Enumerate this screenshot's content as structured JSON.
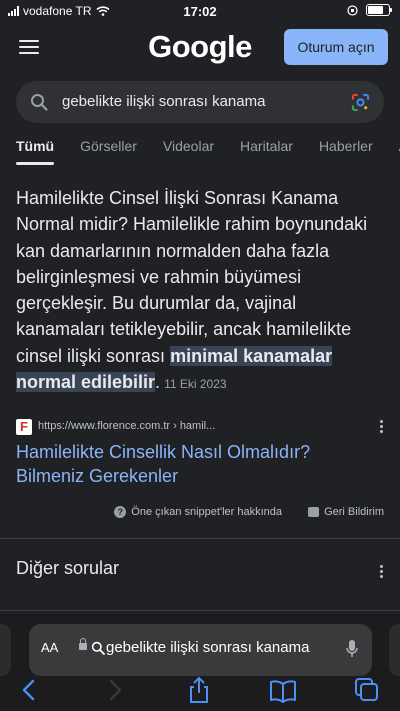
{
  "status_bar": {
    "carrier": "vodafone TR",
    "time": "17:02"
  },
  "header": {
    "logo": "Google",
    "signin_label": "Oturum açın"
  },
  "search": {
    "query": "gebelikte ilişki sonrası kanama"
  },
  "tabs": [
    {
      "label": "Tümü",
      "active": true
    },
    {
      "label": "Görseller"
    },
    {
      "label": "Videolar"
    },
    {
      "label": "Haritalar"
    },
    {
      "label": "Haberler"
    },
    {
      "label": "Al"
    }
  ],
  "featured_snippet": {
    "text": "Hamilelikte Cinsel İlişki Sonrası Kanama Normal midir? Hamilelikle rahim boynundaki kan damarlarının normalden daha fazla belirginleşmesi ve rahmin büyümesi gerçekleşir. Bu durumlar da, vajinal kanamaları tetikleyebilir, ancak hamilelikte cinsel ilişki sonrası",
    "highlight": "minimal kanamalar normal edilebilir",
    "trailing": ".",
    "date": "11 Eki 2023"
  },
  "source": {
    "favicon_letter": "F",
    "url": "https://www.florence.com.tr › hamil...",
    "title": "Hamilelikte Cinsellik Nasıl Olmalıdır? Bilmeniz Gerekenler"
  },
  "snippet_footer": {
    "about_label": "Öne çıkan snippet'ler hakkında",
    "feedback_label": "Geri Bildirim"
  },
  "people_also_ask": {
    "title": "Diğer sorular"
  },
  "safari": {
    "aa_label": "AA",
    "address_text": "gebelikte ilişki sonrası kanama"
  },
  "colors": {
    "link": "#8ab4f8",
    "highlight_bg": "#394457",
    "background": "#202124"
  }
}
